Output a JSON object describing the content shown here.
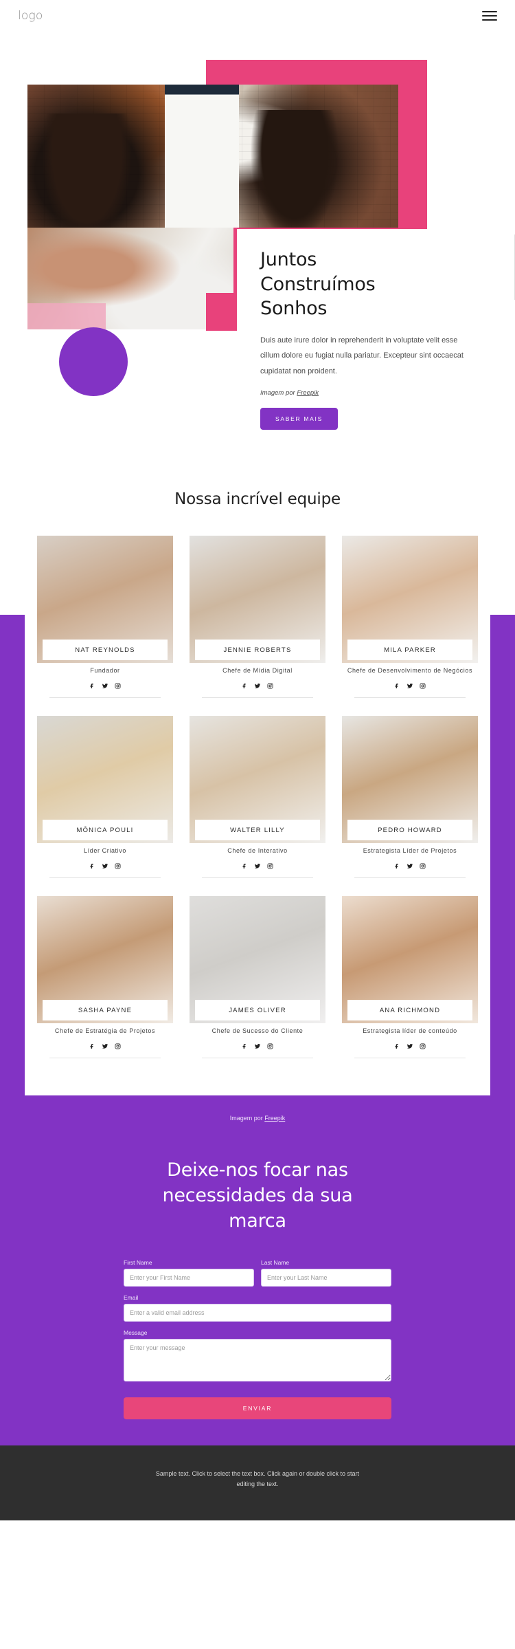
{
  "header": {
    "logo": "logo",
    "menu_icon": "hamburger-icon"
  },
  "hero": {
    "title_lines": [
      "Juntos",
      "Construímos",
      "Sonhos"
    ],
    "paragraph": "Duis aute irure dolor in reprehenderit in voluptate velit esse cillum dolore eu fugiat nulla pariatur. Excepteur sint occaecat cupidatat non proident.",
    "credit_prefix": "Imagem por ",
    "credit_link": "Freepik",
    "cta_label": "SABER MAIS",
    "accent_pink": "#e8427b",
    "accent_purple": "#8233c4"
  },
  "team": {
    "title": "Nossa incrível equipe",
    "members": [
      {
        "name": "NAT REYNOLDS",
        "role": "Fundador"
      },
      {
        "name": "JENNIE ROBERTS",
        "role": "Chefe de Mídia Digital"
      },
      {
        "name": "MILA PARKER",
        "role": "Chefe de Desenvolvimento de Negócios"
      },
      {
        "name": "MÔNICA POULI",
        "role": "Líder Criativo"
      },
      {
        "name": "WALTER LILLY",
        "role": "Chefe de Interativo"
      },
      {
        "name": "PEDRO HOWARD",
        "role": "Estrategista Líder de Projetos"
      },
      {
        "name": "SASHA PAYNE",
        "role": "Chefe de Estratégia de Projetos"
      },
      {
        "name": "JAMES OLIVER",
        "role": "Chefe de Sucesso do Cliente"
      },
      {
        "name": "ANA RICHMOND",
        "role": "Estrategista líder de conteúdo"
      }
    ],
    "social_icons": [
      "facebook-icon",
      "twitter-icon",
      "instagram-icon"
    ]
  },
  "cta": {
    "credit_prefix": "Imagem por ",
    "credit_link": "Freepik",
    "heading": "Deixe-nos focar nas necessidades da sua marca",
    "fields": {
      "first_name_label": "First Name",
      "first_name_placeholder": "Enter your First Name",
      "first_name_value": "",
      "last_name_label": "Last Name",
      "last_name_placeholder": "Enter your Last Name",
      "last_name_value": "",
      "email_label": "Email",
      "email_placeholder": "Enter a valid email address",
      "email_value": "",
      "message_label": "Message",
      "message_placeholder": "Enter your message",
      "message_value": ""
    },
    "submit_label": "ENVIAR",
    "background": "#8233c4",
    "submit_color": "#e8467a"
  },
  "footer": {
    "text": "Sample text. Click to select the text box. Click again or double click to start editing the text.",
    "background": "#2f2f2f"
  }
}
